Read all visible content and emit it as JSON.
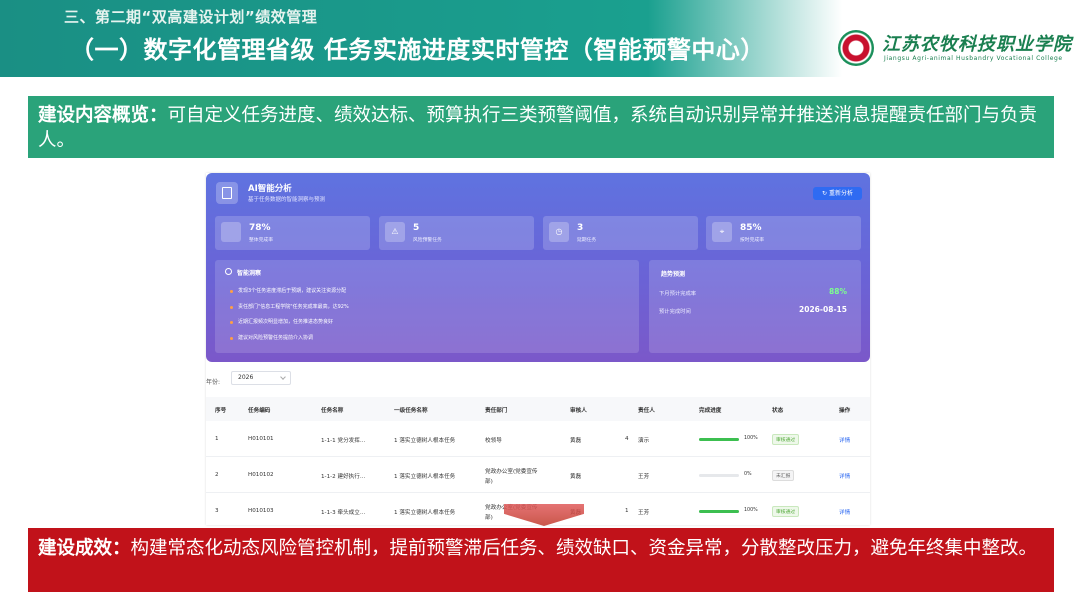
{
  "header": {
    "subtitle": "三、第二期“双高建设计划”绩效管理",
    "title": "（一）数字化管理省级 任务实施进度实时管控（智能预警中心）",
    "school_cn": "江苏农牧科技职业学院",
    "school_en": "Jiangsu Agri-animal Husbandry Vocational College"
  },
  "overview": {
    "label": "建设内容概览：",
    "text": "可自定义任务进度、绩效达标、预算执行三类预警阈值，系统自动识别异常并推送消息提醒责任部门与负责人。"
  },
  "ai_panel": {
    "title": "AI智能分析",
    "subtitle": "基于任务数据的智能洞察与预测",
    "reanalyze": "重新分析",
    "stats": [
      {
        "value": "78%",
        "label": "整体完成率",
        "icon": "chart-icon"
      },
      {
        "value": "5",
        "label": "风险预警任务",
        "icon": "warning-icon"
      },
      {
        "value": "3",
        "label": "延期任务",
        "icon": "clock-icon"
      },
      {
        "value": "85%",
        "label": "按时完成率",
        "icon": "target-icon"
      }
    ],
    "insight_title": "智能洞察",
    "insights": [
      "发现3个任务进度滞后于预期，建议关注资源分配",
      "责任部门\"信息工程学院\"任务完成率最高，达92%",
      "近期汇报频次明显增加，任务推进态势良好",
      "建议对风险预警任务提前介入协调"
    ],
    "trend_title": "趋势预测",
    "trend_rows": [
      {
        "label": "下月预计完成率",
        "value": "88%"
      },
      {
        "label": "预计完成时间",
        "value": "2026-08-15"
      }
    ]
  },
  "filter": {
    "year_label": "年份:",
    "year_value": "2026"
  },
  "table": {
    "headers": [
      "序号",
      "任务编码",
      "任务名称",
      "一级任务名称",
      "责任部门",
      "审核人",
      "责任人",
      "完成进度",
      "状态",
      "操作"
    ],
    "rows": [
      {
        "no": "1",
        "code": "H010101",
        "name": "1-1-1 党分发挥…",
        "parent": "1 落实立德树人根本任务",
        "dept": "校领导",
        "dept2": "",
        "reviewer": "黄磊",
        "extra": "4",
        "owner": "演示",
        "progress": 100,
        "progress_text": "100%",
        "status": "审核通过",
        "action": "详情"
      },
      {
        "no": "2",
        "code": "H010102",
        "name": "1-1-2 建好执行…",
        "parent": "1 落实立德树人根本任务",
        "dept": "党政办公室(党委宣传",
        "dept2": "部)",
        "reviewer": "黄磊",
        "extra": "",
        "owner": "王芳",
        "progress": 0,
        "progress_text": "0%",
        "status": "未汇报",
        "action": "详情"
      },
      {
        "no": "3",
        "code": "H010103",
        "name": "1-1-3 牵头成立…",
        "parent": "1 落实立德树人根本任务",
        "dept": "党政办公室(党委宣传",
        "dept2": "部)",
        "reviewer": "黄磊",
        "extra": "1",
        "owner": "王芳",
        "progress": 100,
        "progress_text": "100%",
        "status": "审核通过",
        "action": "详情"
      }
    ]
  },
  "result": {
    "label": "建设成效：",
    "text": "构建常态化动态风险管控机制，提前预警滞后任务、绩效缺口、资金异常，分散整改压力，避免年终集中整改。"
  },
  "colors": {
    "header_teal": "#1a8f84",
    "overview_green": "#2aa37a",
    "result_red": "#c1121a",
    "panel_purple": "#6a63d6",
    "progress_green": "#3cbf50"
  }
}
